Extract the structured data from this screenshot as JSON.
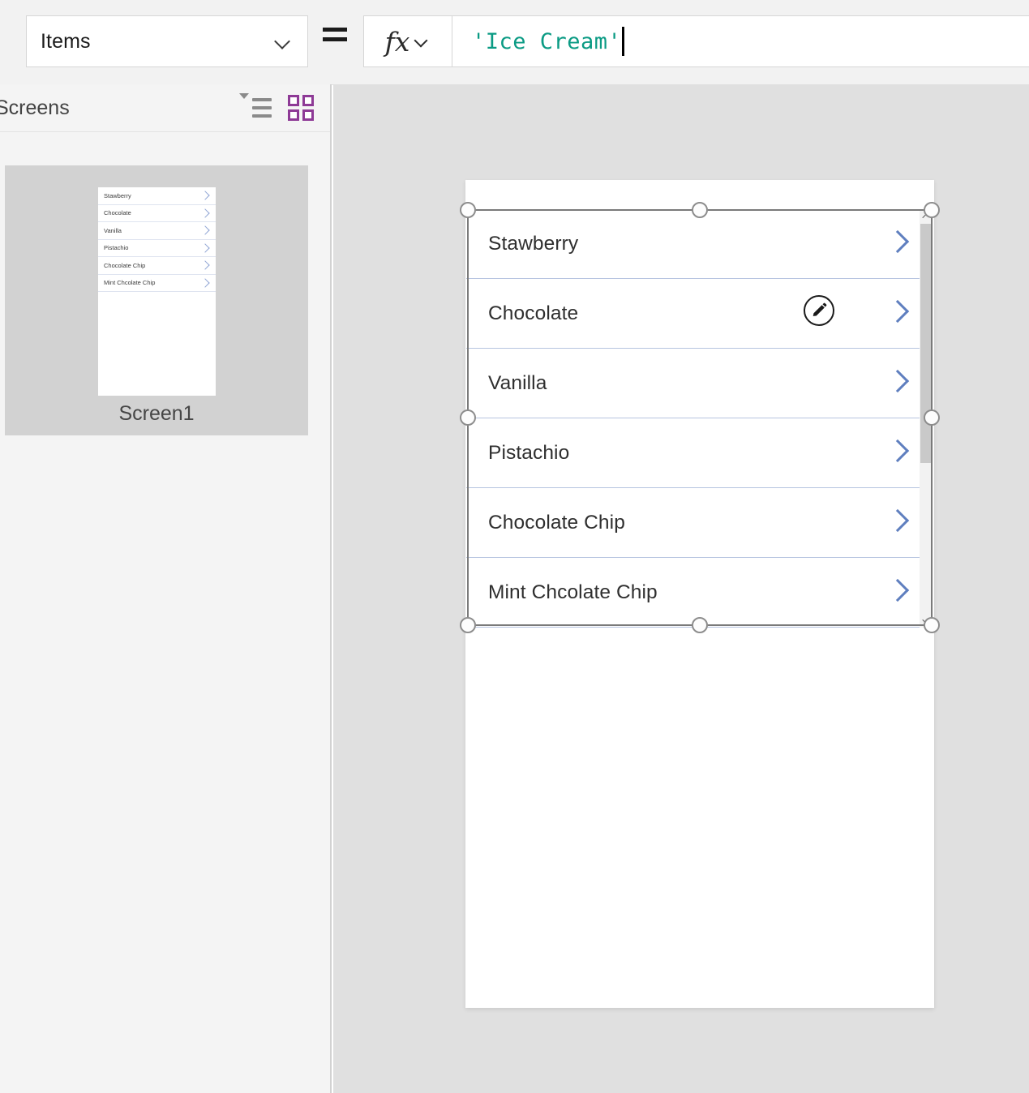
{
  "formula_bar": {
    "property_name": "Items",
    "property_dropdown_icon": "chevron-down-icon",
    "equals_label": "=",
    "fx_label": "fx",
    "fx_dropdown_icon": "chevron-down-icon",
    "formula_value": "'Ice Cream'",
    "formula_text_color": "#0b9b84",
    "caret_visible": true
  },
  "left_panel": {
    "title": "Screens",
    "title_truncated": true,
    "tree_view_icon": "tree-view-icon",
    "thumbnail_view_icon": "thumbnail-grid-icon",
    "thumbnail_view_active": true,
    "accent_color": "#8e3a96",
    "screen": {
      "name": "Screen1",
      "selected": true,
      "items": [
        "Stawberry",
        "Chocolate",
        "Vanilla",
        "Pistachio",
        "Chocolate Chip",
        "Mint Chcolate Chip"
      ]
    }
  },
  "canvas": {
    "background_color": "#e0e0e0",
    "screen_background": "#ffffff",
    "gallery": {
      "selected": true,
      "chevron_color": "#5f7fbf",
      "separator_color": "#b6c4e0",
      "edit_badge_icon": "pencil-edit-icon",
      "items": [
        {
          "label": "Stawberry"
        },
        {
          "label": "Chocolate"
        },
        {
          "label": "Vanilla"
        },
        {
          "label": "Pistachio"
        },
        {
          "label": "Chocolate Chip"
        },
        {
          "label": "Mint Chcolate Chip"
        }
      ],
      "scrollbar": {
        "up_arrow_icon": "chevron-up-icon",
        "down_arrow_icon": "chevron-down-icon",
        "thumb_color": "#c9c9c9",
        "track_color": "#f2f2f2"
      }
    },
    "selection": {
      "border_color": "#7a7a7a",
      "handle_count": 8
    }
  }
}
